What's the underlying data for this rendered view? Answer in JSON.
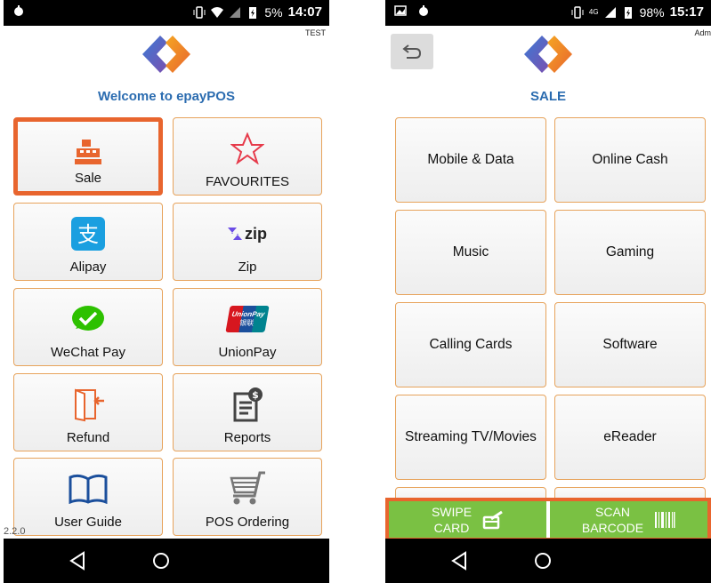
{
  "left": {
    "status": {
      "battery": "5%",
      "time": "14:07"
    },
    "corner_label": "TEST",
    "welcome": "Welcome to epayPOS",
    "tiles": [
      {
        "label": "Sale",
        "icon": "cash-register-icon"
      },
      {
        "label": "FAVOURITES",
        "icon": "star-icon"
      },
      {
        "label": "Alipay",
        "icon": "alipay-icon"
      },
      {
        "label": "Zip",
        "icon": "zip-icon"
      },
      {
        "label": "WeChat Pay",
        "icon": "wechat-icon"
      },
      {
        "label": "UnionPay",
        "icon": "unionpay-icon"
      },
      {
        "label": "Refund",
        "icon": "refund-icon"
      },
      {
        "label": "Reports",
        "icon": "reports-icon"
      },
      {
        "label": "User Guide",
        "icon": "book-icon"
      },
      {
        "label": "POS Ordering",
        "icon": "cart-icon"
      }
    ],
    "zip_text": "zip",
    "unionpay_text": "UnionPay",
    "unionpay_cn": "银联",
    "version": "2.2.0"
  },
  "right": {
    "status": {
      "network": "4G",
      "battery": "98%",
      "time": "15:17"
    },
    "corner_label": "Admi",
    "title": "SALE",
    "tiles": [
      {
        "label": "Mobile & Data"
      },
      {
        "label": "Online Cash"
      },
      {
        "label": "Music"
      },
      {
        "label": "Gaming"
      },
      {
        "label": "Calling Cards"
      },
      {
        "label": "Software"
      },
      {
        "label": "Streaming TV/Movies"
      },
      {
        "label": "eReader"
      }
    ],
    "actions": {
      "swipe_line1": "SWIPE",
      "swipe_line2": "CARD",
      "scan_line1": "SCAN",
      "scan_line2": "BARCODE"
    }
  },
  "colors": {
    "accent": "#e8652e",
    "tile_border": "#e7a35b",
    "title_blue": "#2b6cb0",
    "green": "#7ac143"
  }
}
